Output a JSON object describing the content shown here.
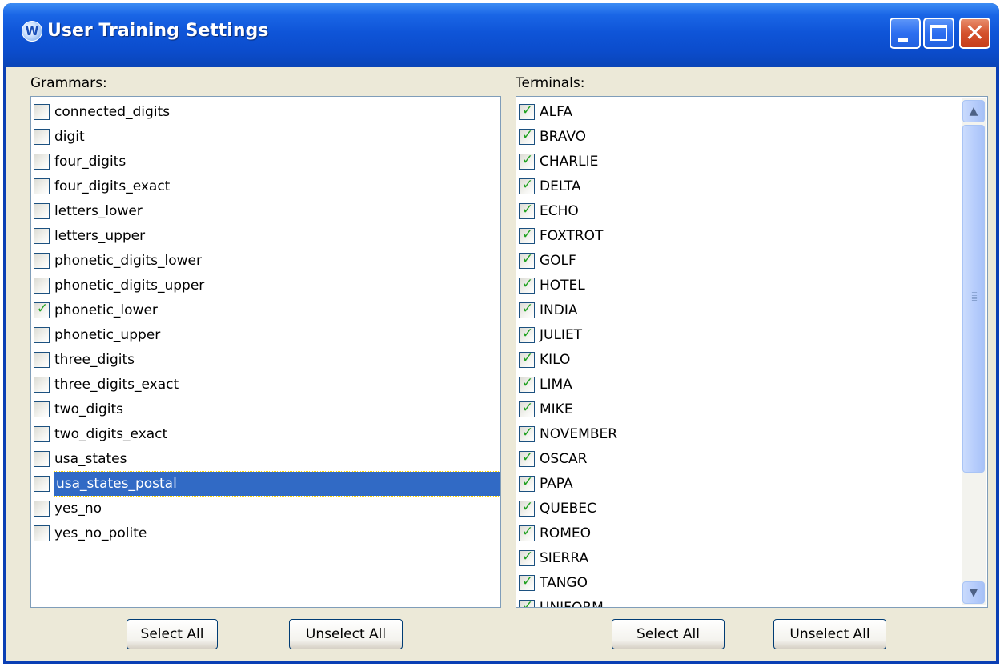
{
  "window": {
    "title": "User Training Settings",
    "app_icon": "W"
  },
  "grammars": {
    "label": "Grammars:",
    "items": [
      {
        "label": "connected_digits",
        "checked": false
      },
      {
        "label": "digit",
        "checked": false
      },
      {
        "label": "four_digits",
        "checked": false
      },
      {
        "label": "four_digits_exact",
        "checked": false
      },
      {
        "label": "letters_lower",
        "checked": false
      },
      {
        "label": "letters_upper",
        "checked": false
      },
      {
        "label": "phonetic_digits_lower",
        "checked": false
      },
      {
        "label": "phonetic_digits_upper",
        "checked": false
      },
      {
        "label": "phonetic_lower",
        "checked": true
      },
      {
        "label": "phonetic_upper",
        "checked": false
      },
      {
        "label": "three_digits",
        "checked": false
      },
      {
        "label": "three_digits_exact",
        "checked": false
      },
      {
        "label": "two_digits",
        "checked": false
      },
      {
        "label": "two_digits_exact",
        "checked": false
      },
      {
        "label": "usa_states",
        "checked": false
      },
      {
        "label": "usa_states_postal",
        "checked": false,
        "selected": true
      },
      {
        "label": "yes_no",
        "checked": false
      },
      {
        "label": "yes_no_polite",
        "checked": false
      }
    ],
    "select_all_label": "Select All",
    "unselect_all_label": "Unselect All"
  },
  "terminals": {
    "label": "Terminals:",
    "items": [
      {
        "label": "ALFA",
        "checked": true
      },
      {
        "label": "BRAVO",
        "checked": true
      },
      {
        "label": "CHARLIE",
        "checked": true
      },
      {
        "label": "DELTA",
        "checked": true
      },
      {
        "label": "ECHO",
        "checked": true
      },
      {
        "label": "FOXTROT",
        "checked": true
      },
      {
        "label": "GOLF",
        "checked": true
      },
      {
        "label": "HOTEL",
        "checked": true
      },
      {
        "label": "INDIA",
        "checked": true
      },
      {
        "label": "JULIET",
        "checked": true
      },
      {
        "label": "KILO",
        "checked": true
      },
      {
        "label": "LIMA",
        "checked": true
      },
      {
        "label": "MIKE",
        "checked": true
      },
      {
        "label": "NOVEMBER",
        "checked": true
      },
      {
        "label": "OSCAR",
        "checked": true
      },
      {
        "label": "PAPA",
        "checked": true
      },
      {
        "label": "QUEBEC",
        "checked": true
      },
      {
        "label": "ROMEO",
        "checked": true
      },
      {
        "label": "SIERRA",
        "checked": true
      },
      {
        "label": "TANGO",
        "checked": true
      },
      {
        "label": "UNIFORM",
        "checked": true
      }
    ],
    "scroll_position_fraction": 0.0,
    "select_all_label": "Select All",
    "unselect_all_label": "Unselect All"
  },
  "colors": {
    "title_bar": "#0b4ccc",
    "window_background": "#ece9d8",
    "selection": "#316ac5",
    "checkmark": "#21a121",
    "close_button": "#d4512c"
  },
  "icons": {
    "app": "app-logo-icon",
    "minimize": "minimize-icon",
    "maximize": "maximize-icon",
    "close": "close-icon",
    "scroll_up": "chevron-up-icon",
    "scroll_down": "chevron-down-icon",
    "check": "checkmark-icon"
  }
}
